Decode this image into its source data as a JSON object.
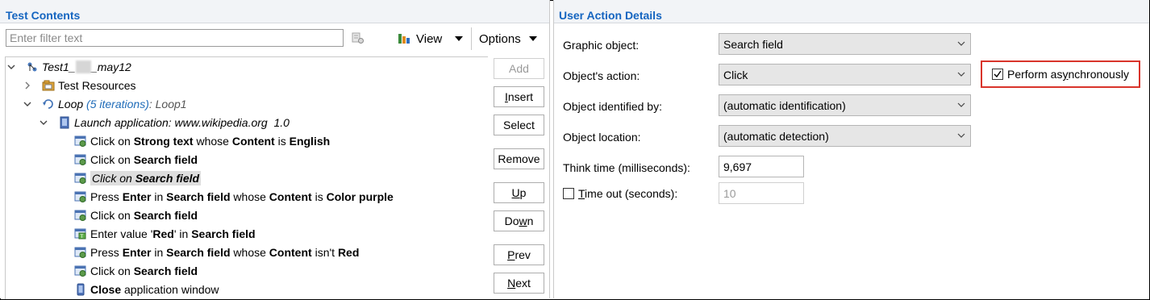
{
  "test_contents": {
    "title": "Test Contents",
    "filter_placeholder": "Enter filter text",
    "view_label": "View",
    "options_label": "Options",
    "tree": [
      {
        "kind": "root",
        "parts": [
          {
            "t": "Test1_",
            "s": "it"
          },
          {
            "t": "     ",
            "s": "blur"
          },
          {
            "t": "_may12",
            "s": "it"
          }
        ]
      },
      {
        "kind": "folder",
        "parts": [
          {
            "t": "Test Resources",
            "s": "n"
          }
        ]
      },
      {
        "kind": "loop",
        "parts": [
          {
            "t": "Loop ",
            "s": "it"
          },
          {
            "t": "(5 iterations)",
            "s": "blue"
          },
          {
            "t": ": Loop1",
            "s": "gray"
          }
        ]
      },
      {
        "kind": "app",
        "parts": [
          {
            "t": "Launch application: www.wikipedia.org  1.0",
            "s": "it"
          }
        ]
      },
      {
        "kind": "action",
        "parts": [
          {
            "t": "Click on ",
            "s": "n"
          },
          {
            "t": "Strong text",
            "s": "b"
          },
          {
            "t": " whose ",
            "s": "n"
          },
          {
            "t": "Content",
            "s": "b"
          },
          {
            "t": " is ",
            "s": "n"
          },
          {
            "t": "English",
            "s": "b"
          }
        ]
      },
      {
        "kind": "action",
        "parts": [
          {
            "t": "Click on ",
            "s": "n"
          },
          {
            "t": "Search field",
            "s": "b"
          }
        ]
      },
      {
        "kind": "action",
        "selected": true,
        "parts": [
          {
            "t": "Click on ",
            "s": "it"
          },
          {
            "t": "Search field",
            "s": "bi"
          }
        ]
      },
      {
        "kind": "action",
        "parts": [
          {
            "t": "Press ",
            "s": "n"
          },
          {
            "t": "Enter",
            "s": "b"
          },
          {
            "t": " in ",
            "s": "n"
          },
          {
            "t": "Search field",
            "s": "b"
          },
          {
            "t": " whose ",
            "s": "n"
          },
          {
            "t": "Content",
            "s": "b"
          },
          {
            "t": " is ",
            "s": "n"
          },
          {
            "t": "Color purple",
            "s": "b"
          }
        ]
      },
      {
        "kind": "action",
        "parts": [
          {
            "t": "Click on ",
            "s": "n"
          },
          {
            "t": "Search field",
            "s": "b"
          }
        ]
      },
      {
        "kind": "enter",
        "parts": [
          {
            "t": "Enter value '",
            "s": "n"
          },
          {
            "t": "Red",
            "s": "b"
          },
          {
            "t": "' in ",
            "s": "n"
          },
          {
            "t": "Search field",
            "s": "b"
          }
        ]
      },
      {
        "kind": "action",
        "parts": [
          {
            "t": "Press ",
            "s": "n"
          },
          {
            "t": "Enter",
            "s": "b"
          },
          {
            "t": " in ",
            "s": "n"
          },
          {
            "t": "Search field",
            "s": "b"
          },
          {
            "t": " whose ",
            "s": "n"
          },
          {
            "t": "Content",
            "s": "b"
          },
          {
            "t": " isn't ",
            "s": "n"
          },
          {
            "t": "Red",
            "s": "b"
          }
        ]
      },
      {
        "kind": "action",
        "parts": [
          {
            "t": "Click on ",
            "s": "n"
          },
          {
            "t": "Search field",
            "s": "b"
          }
        ]
      },
      {
        "kind": "close",
        "parts": [
          {
            "t": "Close",
            "s": "b"
          },
          {
            "t": " application window",
            "s": "n"
          }
        ]
      }
    ],
    "buttons": {
      "add": {
        "pre": "",
        "u": "",
        "post": "Add"
      },
      "insert": {
        "pre": "",
        "u": "I",
        "post": "nsert"
      },
      "select": {
        "pre": "",
        "u": "",
        "post": "Select"
      },
      "remove": {
        "pre": "",
        "u": "",
        "post": "Remove"
      },
      "up": {
        "pre": "",
        "u": "U",
        "post": "p"
      },
      "down": {
        "pre": "Do",
        "u": "w",
        "post": "n"
      },
      "prev": {
        "pre": "",
        "u": "P",
        "post": "rev"
      },
      "next": {
        "pre": "",
        "u": "N",
        "post": "ext"
      }
    }
  },
  "details": {
    "title": "User Action Details",
    "graphic_object_label": "Graphic object:",
    "graphic_object_value": "Search field",
    "action_label": "Object's action:",
    "action_value": "Click",
    "identified_label": "Object identified by:",
    "identified_value": "(automatic identification)",
    "location_label": "Object location:",
    "location_value": "(automatic detection)",
    "think_time_label": "Think time (milliseconds):",
    "think_time_value": "9,697",
    "timeout_label_u": "T",
    "timeout_label_rest": "ime out (seconds):",
    "timeout_value": "10",
    "timeout_checked": false,
    "async_label_pre": "Perform as",
    "async_label_u": "y",
    "async_label_post": "nchronously",
    "async_checked": true,
    "highlight_color": "#d9342b"
  }
}
